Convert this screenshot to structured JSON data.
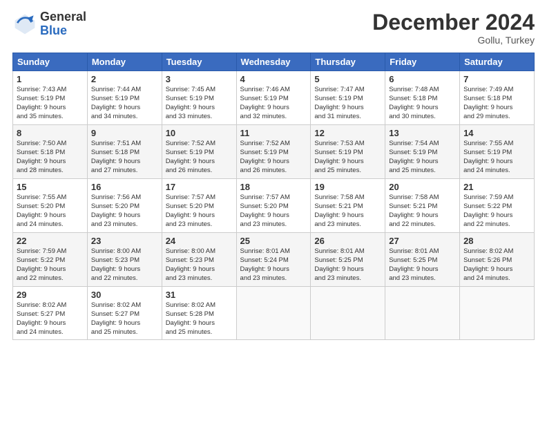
{
  "logo": {
    "general": "General",
    "blue": "Blue"
  },
  "title": {
    "month": "December 2024",
    "location": "Gollu, Turkey"
  },
  "weekdays": [
    "Sunday",
    "Monday",
    "Tuesday",
    "Wednesday",
    "Thursday",
    "Friday",
    "Saturday"
  ],
  "weeks": [
    [
      {
        "day": "1",
        "lines": [
          "Sunrise: 7:43 AM",
          "Sunset: 5:19 PM",
          "Daylight: 9 hours",
          "and 35 minutes."
        ]
      },
      {
        "day": "2",
        "lines": [
          "Sunrise: 7:44 AM",
          "Sunset: 5:19 PM",
          "Daylight: 9 hours",
          "and 34 minutes."
        ]
      },
      {
        "day": "3",
        "lines": [
          "Sunrise: 7:45 AM",
          "Sunset: 5:19 PM",
          "Daylight: 9 hours",
          "and 33 minutes."
        ]
      },
      {
        "day": "4",
        "lines": [
          "Sunrise: 7:46 AM",
          "Sunset: 5:19 PM",
          "Daylight: 9 hours",
          "and 32 minutes."
        ]
      },
      {
        "day": "5",
        "lines": [
          "Sunrise: 7:47 AM",
          "Sunset: 5:19 PM",
          "Daylight: 9 hours",
          "and 31 minutes."
        ]
      },
      {
        "day": "6",
        "lines": [
          "Sunrise: 7:48 AM",
          "Sunset: 5:18 PM",
          "Daylight: 9 hours",
          "and 30 minutes."
        ]
      },
      {
        "day": "7",
        "lines": [
          "Sunrise: 7:49 AM",
          "Sunset: 5:18 PM",
          "Daylight: 9 hours",
          "and 29 minutes."
        ]
      }
    ],
    [
      {
        "day": "8",
        "lines": [
          "Sunrise: 7:50 AM",
          "Sunset: 5:18 PM",
          "Daylight: 9 hours",
          "and 28 minutes."
        ]
      },
      {
        "day": "9",
        "lines": [
          "Sunrise: 7:51 AM",
          "Sunset: 5:18 PM",
          "Daylight: 9 hours",
          "and 27 minutes."
        ]
      },
      {
        "day": "10",
        "lines": [
          "Sunrise: 7:52 AM",
          "Sunset: 5:19 PM",
          "Daylight: 9 hours",
          "and 26 minutes."
        ]
      },
      {
        "day": "11",
        "lines": [
          "Sunrise: 7:52 AM",
          "Sunset: 5:19 PM",
          "Daylight: 9 hours",
          "and 26 minutes."
        ]
      },
      {
        "day": "12",
        "lines": [
          "Sunrise: 7:53 AM",
          "Sunset: 5:19 PM",
          "Daylight: 9 hours",
          "and 25 minutes."
        ]
      },
      {
        "day": "13",
        "lines": [
          "Sunrise: 7:54 AM",
          "Sunset: 5:19 PM",
          "Daylight: 9 hours",
          "and 25 minutes."
        ]
      },
      {
        "day": "14",
        "lines": [
          "Sunrise: 7:55 AM",
          "Sunset: 5:19 PM",
          "Daylight: 9 hours",
          "and 24 minutes."
        ]
      }
    ],
    [
      {
        "day": "15",
        "lines": [
          "Sunrise: 7:55 AM",
          "Sunset: 5:20 PM",
          "Daylight: 9 hours",
          "and 24 minutes."
        ]
      },
      {
        "day": "16",
        "lines": [
          "Sunrise: 7:56 AM",
          "Sunset: 5:20 PM",
          "Daylight: 9 hours",
          "and 23 minutes."
        ]
      },
      {
        "day": "17",
        "lines": [
          "Sunrise: 7:57 AM",
          "Sunset: 5:20 PM",
          "Daylight: 9 hours",
          "and 23 minutes."
        ]
      },
      {
        "day": "18",
        "lines": [
          "Sunrise: 7:57 AM",
          "Sunset: 5:20 PM",
          "Daylight: 9 hours",
          "and 23 minutes."
        ]
      },
      {
        "day": "19",
        "lines": [
          "Sunrise: 7:58 AM",
          "Sunset: 5:21 PM",
          "Daylight: 9 hours",
          "and 23 minutes."
        ]
      },
      {
        "day": "20",
        "lines": [
          "Sunrise: 7:58 AM",
          "Sunset: 5:21 PM",
          "Daylight: 9 hours",
          "and 22 minutes."
        ]
      },
      {
        "day": "21",
        "lines": [
          "Sunrise: 7:59 AM",
          "Sunset: 5:22 PM",
          "Daylight: 9 hours",
          "and 22 minutes."
        ]
      }
    ],
    [
      {
        "day": "22",
        "lines": [
          "Sunrise: 7:59 AM",
          "Sunset: 5:22 PM",
          "Daylight: 9 hours",
          "and 22 minutes."
        ]
      },
      {
        "day": "23",
        "lines": [
          "Sunrise: 8:00 AM",
          "Sunset: 5:23 PM",
          "Daylight: 9 hours",
          "and 22 minutes."
        ]
      },
      {
        "day": "24",
        "lines": [
          "Sunrise: 8:00 AM",
          "Sunset: 5:23 PM",
          "Daylight: 9 hours",
          "and 23 minutes."
        ]
      },
      {
        "day": "25",
        "lines": [
          "Sunrise: 8:01 AM",
          "Sunset: 5:24 PM",
          "Daylight: 9 hours",
          "and 23 minutes."
        ]
      },
      {
        "day": "26",
        "lines": [
          "Sunrise: 8:01 AM",
          "Sunset: 5:25 PM",
          "Daylight: 9 hours",
          "and 23 minutes."
        ]
      },
      {
        "day": "27",
        "lines": [
          "Sunrise: 8:01 AM",
          "Sunset: 5:25 PM",
          "Daylight: 9 hours",
          "and 23 minutes."
        ]
      },
      {
        "day": "28",
        "lines": [
          "Sunrise: 8:02 AM",
          "Sunset: 5:26 PM",
          "Daylight: 9 hours",
          "and 24 minutes."
        ]
      }
    ],
    [
      {
        "day": "29",
        "lines": [
          "Sunrise: 8:02 AM",
          "Sunset: 5:27 PM",
          "Daylight: 9 hours",
          "and 24 minutes."
        ]
      },
      {
        "day": "30",
        "lines": [
          "Sunrise: 8:02 AM",
          "Sunset: 5:27 PM",
          "Daylight: 9 hours",
          "and 25 minutes."
        ]
      },
      {
        "day": "31",
        "lines": [
          "Sunrise: 8:02 AM",
          "Sunset: 5:28 PM",
          "Daylight: 9 hours",
          "and 25 minutes."
        ]
      },
      {
        "day": "",
        "lines": []
      },
      {
        "day": "",
        "lines": []
      },
      {
        "day": "",
        "lines": []
      },
      {
        "day": "",
        "lines": []
      }
    ]
  ]
}
